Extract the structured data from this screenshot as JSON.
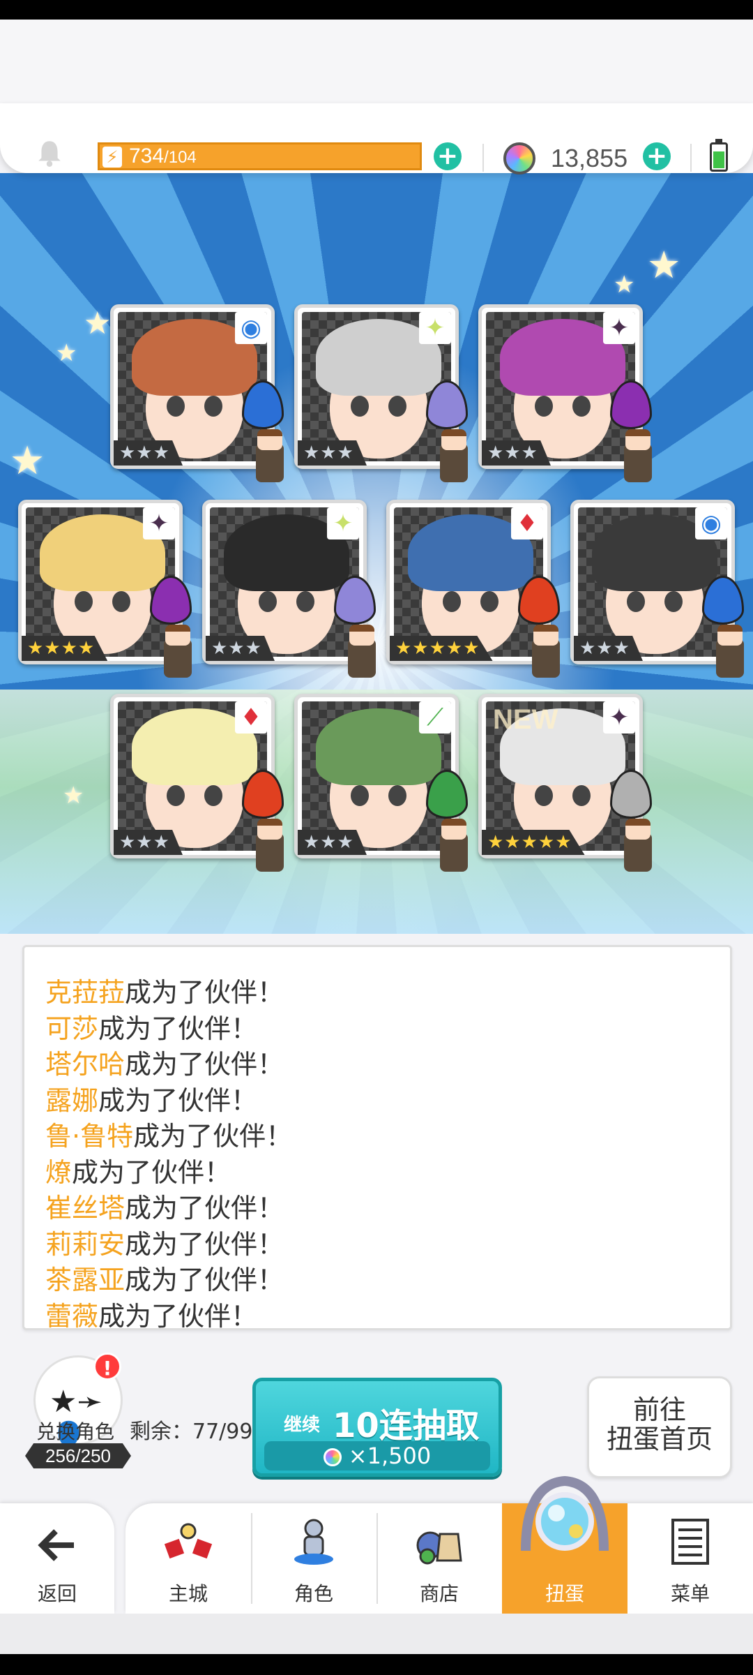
{
  "header": {
    "stamina_current": "734",
    "stamina_max": "/104",
    "gems": "13,855"
  },
  "cards": [
    {
      "element": "◉",
      "element_color": "#2f7fe0",
      "hair": "#c46a42",
      "stars": "★★★",
      "gold": false,
      "shard": "#2b6fd6"
    },
    {
      "element": "✦",
      "element_color": "#c8e06a",
      "hair": "#cfcfcf",
      "stars": "★★★",
      "gold": false,
      "shard": "#8f86d8"
    },
    {
      "element": "✦",
      "element_color": "#4a2e4e",
      "hair": "#b04ab0",
      "stars": "★★★",
      "gold": false,
      "shard": "#8b2fb0"
    },
    {
      "element": "✦",
      "element_color": "#4a2e4e",
      "hair": "#f0d07a",
      "stars": "★★★★",
      "gold": true,
      "shard": "#8b2fb0"
    },
    {
      "element": "✦",
      "element_color": "#c8e06a",
      "hair": "#2a2a2a",
      "stars": "★★★",
      "gold": false,
      "shard": "#8f86d8"
    },
    {
      "element": "♦",
      "element_color": "#e0303a",
      "hair": "#3f6fb0",
      "stars": "★★★★★",
      "gold": true,
      "shard": "#e04020"
    },
    {
      "element": "◉",
      "element_color": "#2f7fe0",
      "hair": "#3a3a3a",
      "stars": "★★★",
      "gold": false,
      "shard": "#2b6fd6"
    },
    {
      "element": "♦",
      "element_color": "#e0303a",
      "hair": "#f4eeb0",
      "stars": "★★★",
      "gold": false,
      "shard": "#e04020"
    },
    {
      "element": "⟋",
      "element_color": "#4fb24f",
      "hair": "#6a9a5a",
      "stars": "★★★",
      "gold": false,
      "shard": "#3aa04a"
    },
    {
      "element": "✦",
      "element_color": "#4a2e4e",
      "hair": "#e6e6e6",
      "stars": "★★★★★",
      "gold": true,
      "shard": "#b0b0b0",
      "new_label": "NEW"
    }
  ],
  "results": [
    {
      "name": "克菈菈",
      "suffix": "成为了伙伴！"
    },
    {
      "name": "可莎",
      "suffix": "成为了伙伴！"
    },
    {
      "name": "塔尔哈",
      "suffix": "成为了伙伴！"
    },
    {
      "name": "露娜",
      "suffix": "成为了伙伴！"
    },
    {
      "name": "鲁·鲁特",
      "suffix": "成为了伙伴！"
    },
    {
      "name": "燎",
      "suffix": "成为了伙伴！"
    },
    {
      "name": "崔丝塔",
      "suffix": "成为了伙伴！"
    },
    {
      "name": "莉莉安",
      "suffix": "成为了伙伴！"
    },
    {
      "name": "茶露亚",
      "suffix": "成为了伙伴！"
    },
    {
      "name": "蕾薇",
      "suffix": "成为了伙伴！"
    }
  ],
  "exchange": {
    "badge": "!",
    "label": "兑换角色",
    "count": "256/250",
    "remaining": "剩余：77/99"
  },
  "pull": {
    "continue_label": "继续",
    "main_label": "10连抽取",
    "cost": "×1,500"
  },
  "home_button": {
    "line1": "前往",
    "line2": "扭蛋首页"
  },
  "nav": {
    "back": "返回",
    "items": [
      "主城",
      "角色",
      "商店",
      "扭蛋",
      "菜单"
    ]
  }
}
